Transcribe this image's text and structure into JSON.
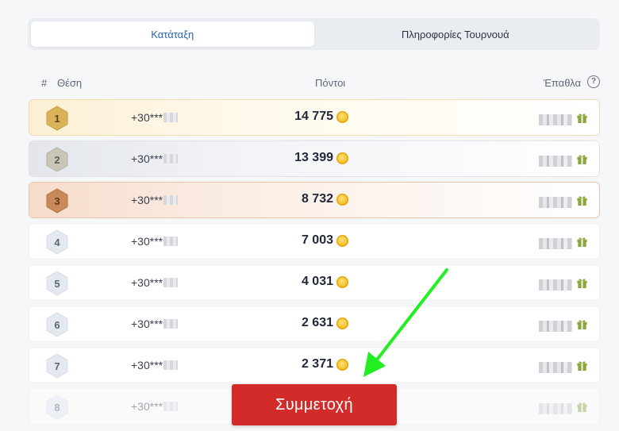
{
  "tabs": [
    {
      "label": "Κατάταξη",
      "active": true
    },
    {
      "label": "Πληροφορίες Τουρνουά",
      "active": false
    }
  ],
  "table_header": {
    "hash": "#",
    "position": "Θέση",
    "points": "Πόντοι",
    "prize": "Έπαθλα",
    "help_icon": "?"
  },
  "rows": [
    {
      "rank": "1",
      "phone": "+30***",
      "points": "14 775",
      "tier": "gold"
    },
    {
      "rank": "2",
      "phone": "+30***",
      "points": "13 399",
      "tier": "silver"
    },
    {
      "rank": "3",
      "phone": "+30***",
      "points": "8 732",
      "tier": "bronze"
    },
    {
      "rank": "4",
      "phone": "+30***",
      "points": "7 003",
      "tier": "default"
    },
    {
      "rank": "5",
      "phone": "+30***",
      "points": "4 031",
      "tier": "default"
    },
    {
      "rank": "6",
      "phone": "+30***",
      "points": "2 631",
      "tier": "default"
    },
    {
      "rank": "7",
      "phone": "+30***",
      "points": "2 371",
      "tier": "default"
    },
    {
      "rank": "8",
      "phone": "+30***",
      "points": "",
      "tier": "default"
    }
  ],
  "cta": {
    "label": "Συμμετοχή"
  },
  "colors": {
    "accent_blue": "#2a64b0",
    "cta_red": "#d32a2a",
    "gold": "#d8b35a",
    "silver": "#c9c6b8",
    "bronze": "#c88a5a",
    "default_badge": "#dfe3ea",
    "gift_green": "#8aa63a",
    "annotation_arrow": "#22ee22"
  },
  "icons": [
    "help-icon",
    "coin-icon",
    "gift-icon",
    "rank-hexagon-icon",
    "annotation-arrow"
  ]
}
